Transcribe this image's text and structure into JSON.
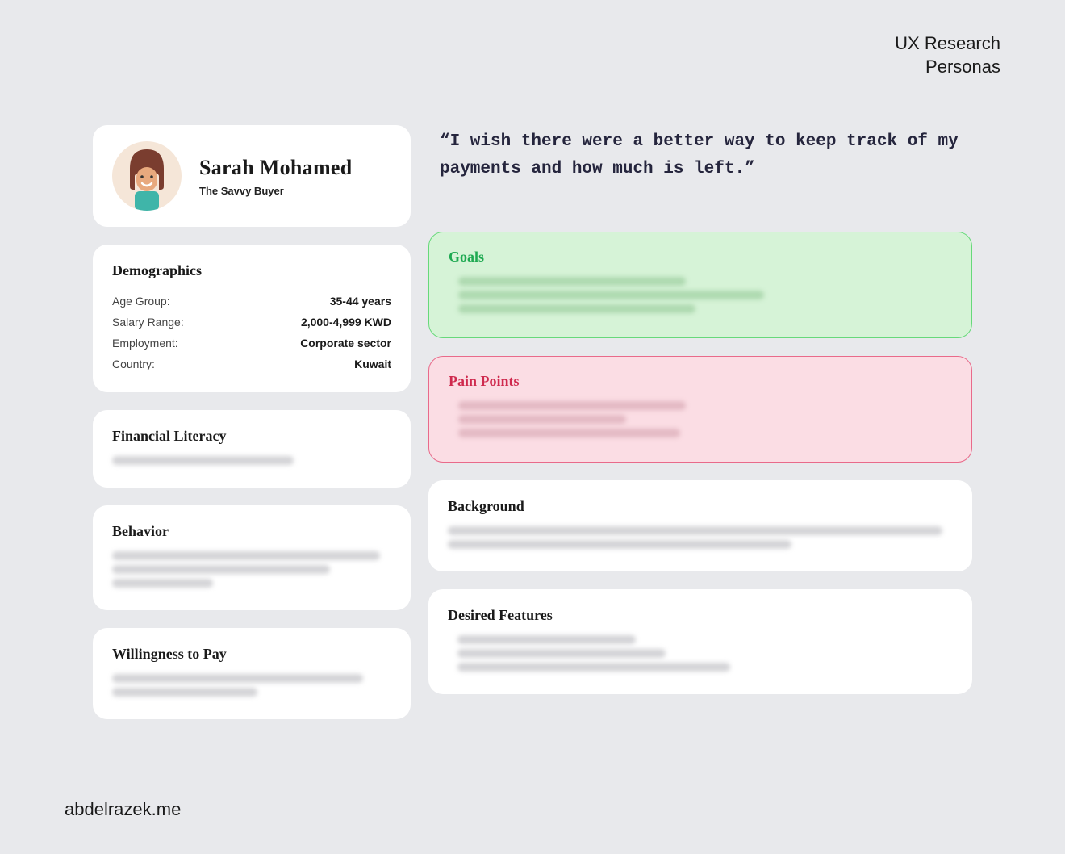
{
  "header": {
    "line1": "UX Research",
    "line2": "Personas"
  },
  "persona": {
    "name": "Sarah Mohamed",
    "role": "The Savvy Buyer"
  },
  "quote": "“I wish there were a better way to keep track of my payments and how much is left.”",
  "demographics": {
    "title": "Demographics",
    "rows": [
      {
        "label": "Age Group:",
        "value": "35-44 years"
      },
      {
        "label": "Salary Range:",
        "value": "2,000-4,999 KWD"
      },
      {
        "label": "Employment:",
        "value": "Corporate sector"
      },
      {
        "label": "Country:",
        "value": "Kuwait"
      }
    ]
  },
  "sections": {
    "financial_literacy": "Financial Literacy",
    "behavior": "Behavior",
    "willingness": "Willingness to Pay",
    "goals": "Goals",
    "pain_points": "Pain Points",
    "background": "Background",
    "desired_features": "Desired Features"
  },
  "footer": "abdelrazek.me"
}
